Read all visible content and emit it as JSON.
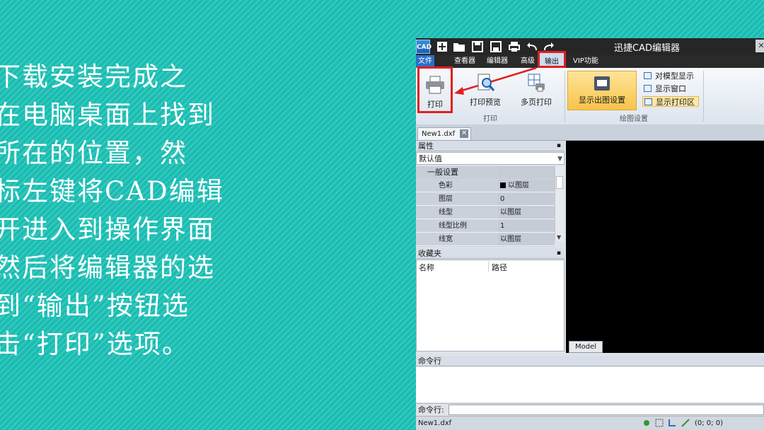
{
  "lesson": {
    "text": "下载安装完成之\n在电脑桌面上找到\n所在的位置，然\n标左键将CAD编辑\n开进入到操作界面\n然后将编辑器的选\n到“输出”按钮选\n击“打印”选项。"
  },
  "app": {
    "logo": "CAD",
    "title": "迅捷CAD编辑器",
    "menu": {
      "file": "文件",
      "viewer": "查看器",
      "editor": "编辑器",
      "advanced": "高级",
      "output": "输出",
      "vip": "VIP功能"
    },
    "ribbon": {
      "print": "打印",
      "print_preview": "打印预览",
      "multi_page_print": "多页打印",
      "print_group": "打印",
      "show_layout_settings": "显示出图设置",
      "model_display": "对模型显示",
      "show_window": "显示窗口",
      "show_print_area": "显示打印区",
      "layout_group": "绘图设置"
    },
    "doc_tab": "New1.dxf",
    "properties": {
      "title": "属性",
      "combo": "默认值",
      "section": "一般设置",
      "rows": [
        {
          "name": "色彩",
          "value": "以图层"
        },
        {
          "name": "图层",
          "value": "0"
        },
        {
          "name": "线型",
          "value": "以图层"
        },
        {
          "name": "线型比例",
          "value": "1"
        },
        {
          "name": "线宽",
          "value": "以图层"
        }
      ]
    },
    "favorites": {
      "title": "收藏夹",
      "col_name": "名称",
      "col_path": "路径"
    },
    "model_tab": "Model",
    "command": {
      "title": "命令行",
      "prompt": "命令行:"
    },
    "status": {
      "file": "New1.dxf",
      "coords": "(0; 0; 0)"
    },
    "colors": {
      "highlight": "#e02020",
      "background": "#19bdb2",
      "ribbon_active": "#f7c44a"
    }
  }
}
